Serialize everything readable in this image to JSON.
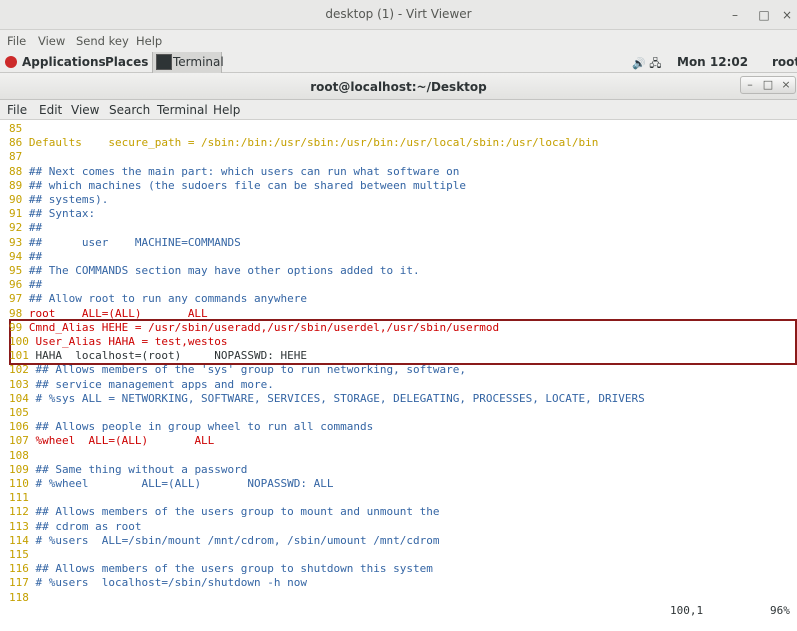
{
  "viewer": {
    "title": "desktop (1) - Virt Viewer",
    "minimize": "–",
    "maximize": "□",
    "close": "×",
    "menu": [
      "File",
      "View",
      "Send key",
      "Help"
    ]
  },
  "topbar": {
    "applications": "Applications",
    "places": "Places",
    "task": "Terminal",
    "tray_icons": "🔊 🖧",
    "clock": "Mon 12:02",
    "user": "root"
  },
  "terminal": {
    "title": "root@localhost:~/Desktop",
    "menu": [
      "File",
      "Edit",
      "View",
      "Search",
      "Terminal",
      "Help"
    ],
    "lines": [
      "85",
      "86 Defaults    secure_path = /sbin:/bin:/usr/sbin:/usr/bin:/usr/local/sbin:/usr/local/bin",
      "87",
      "88 ## Next comes the main part: which users can run what software on",
      "89 ## which machines (the sudoers file can be shared between multiple",
      "90 ## systems).",
      "91 ## Syntax:",
      "92 ##",
      "93 ##      user    MACHINE=COMMANDS",
      "94 ##",
      "95 ## The COMMANDS section may have other options added to it.",
      "96 ##",
      "97 ## Allow root to run any commands anywhere",
      "98 root    ALL=(ALL)       ALL",
      "99 Cmnd_Alias HEHE = /usr/sbin/useradd,/usr/sbin/userdel,/usr/sbin/usermod",
      "100 User_Alias HAHA = test,westos",
      "101 HAHA  localhost=(root)     NOPASSWD: HEHE",
      "102 ## Allows members of the 'sys' group to run networking, software,",
      "103 ## service management apps and more.",
      "104 # %sys ALL = NETWORKING, SOFTWARE, SERVICES, STORAGE, DELEGATING, PROCESSES, LOCATE, DRIVERS",
      "105",
      "106 ## Allows people in group wheel to run all commands",
      "107 %wheel  ALL=(ALL)       ALL",
      "108",
      "109 ## Same thing without a password",
      "110 # %wheel        ALL=(ALL)       NOPASSWD: ALL",
      "111",
      "112 ## Allows members of the users group to mount and unmount the",
      "113 ## cdrom as root",
      "114 # %users  ALL=/sbin/mount /mnt/cdrom, /sbin/umount /mnt/cdrom",
      "115",
      "116 ## Allows members of the users group to shutdown this system",
      "117 # %users  localhost=/sbin/shutdown -h now",
      "118"
    ],
    "status_position": "100,1",
    "status_percent": "96%"
  },
  "colors": {
    "line_number": "#c4a000",
    "comment": "#3465a4",
    "string": "#cc0000",
    "highlight_border": "#8a1a1a"
  }
}
